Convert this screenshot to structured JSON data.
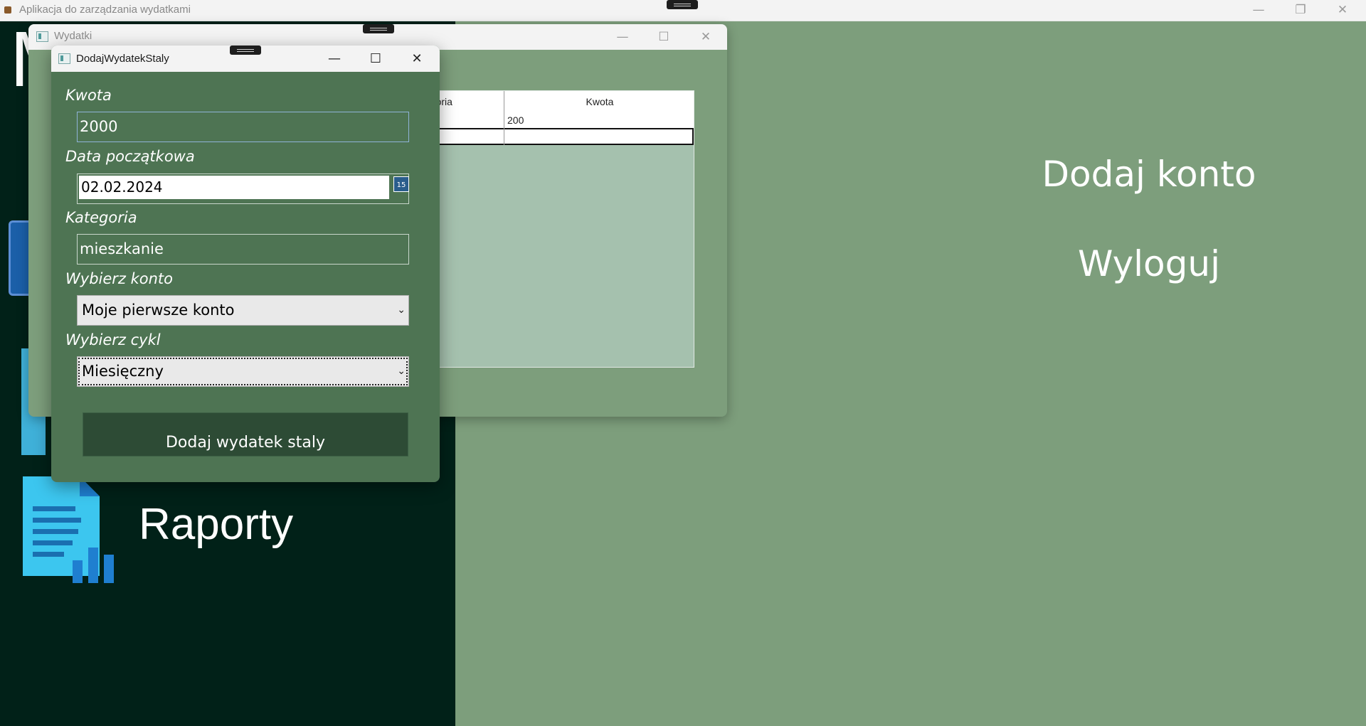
{
  "main_window": {
    "title": "Aplikacja do zarządzania wydatkami",
    "controls": {
      "minimize": "—",
      "restore": "❐",
      "close": "✕"
    }
  },
  "sidebar": {
    "partial_letter": "M",
    "reports_label": "Raporty",
    "reports_icon": "report-chart-icon"
  },
  "right_panel": {
    "add_account": "Dodaj konto",
    "logout": "Wyloguj"
  },
  "wydatki_window": {
    "title": "Wydatki",
    "controls": {
      "minimize": "—",
      "maximize": "☐",
      "close": "✕"
    },
    "grid": {
      "columns": [
        "egoria",
        "Kwota"
      ],
      "rows": [
        [
          "",
          "200"
        ]
      ]
    }
  },
  "dialog": {
    "title": "DodajWydatekStaly",
    "controls": {
      "minimize": "—",
      "maximize": "☐",
      "close": "✕"
    },
    "amount_label": "Kwota",
    "amount_value": "2000",
    "start_date_label": "Data początkowa",
    "start_date_value": "02.02.2024",
    "calendar_icon_text": "15",
    "category_label": "Kategoria",
    "category_value": "mieszkanie",
    "account_label": "Wybierz konto",
    "account_value": "Moje pierwsze konto",
    "cycle_label": "Wybierz cykl",
    "cycle_value": "Miesięczny",
    "submit_label": "Dodaj wydatek staly"
  },
  "colors": {
    "app_background": "#7d9e7c",
    "sidebar": "#012118",
    "dialog_background": "#4e7453",
    "submit_button": "#2d4b35"
  }
}
